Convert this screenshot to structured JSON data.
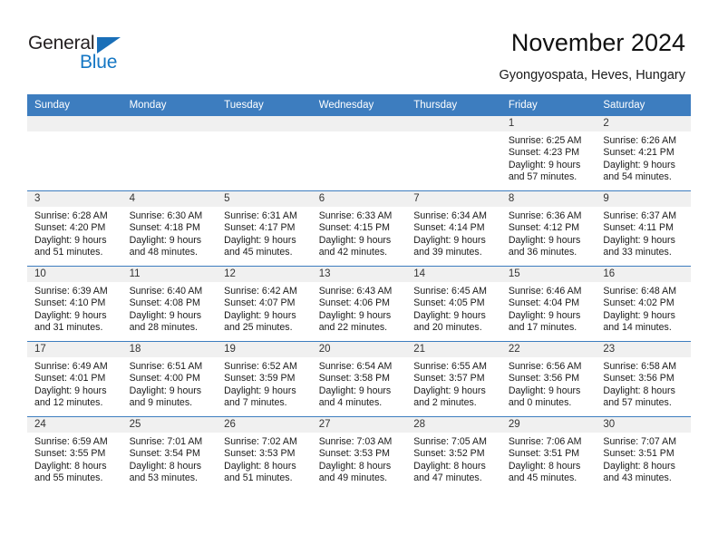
{
  "brand": {
    "name_top": "General",
    "name_bottom": "Blue"
  },
  "header": {
    "title": "November 2024",
    "subtitle": "Gyongyospata, Heves, Hungary"
  },
  "calendar": {
    "weekday_headers": [
      "Sunday",
      "Monday",
      "Tuesday",
      "Wednesday",
      "Thursday",
      "Friday",
      "Saturday"
    ],
    "accent_color": "#3d7dbf",
    "daynum_background": "#f0f0f0",
    "weeks": [
      [
        {
          "day": "",
          "empty": true
        },
        {
          "day": "",
          "empty": true
        },
        {
          "day": "",
          "empty": true
        },
        {
          "day": "",
          "empty": true
        },
        {
          "day": "",
          "empty": true
        },
        {
          "day": "1",
          "sunrise": "Sunrise: 6:25 AM",
          "sunset": "Sunset: 4:23 PM",
          "daylight_line1": "Daylight: 9 hours",
          "daylight_line2": "and 57 minutes."
        },
        {
          "day": "2",
          "sunrise": "Sunrise: 6:26 AM",
          "sunset": "Sunset: 4:21 PM",
          "daylight_line1": "Daylight: 9 hours",
          "daylight_line2": "and 54 minutes."
        }
      ],
      [
        {
          "day": "3",
          "sunrise": "Sunrise: 6:28 AM",
          "sunset": "Sunset: 4:20 PM",
          "daylight_line1": "Daylight: 9 hours",
          "daylight_line2": "and 51 minutes."
        },
        {
          "day": "4",
          "sunrise": "Sunrise: 6:30 AM",
          "sunset": "Sunset: 4:18 PM",
          "daylight_line1": "Daylight: 9 hours",
          "daylight_line2": "and 48 minutes."
        },
        {
          "day": "5",
          "sunrise": "Sunrise: 6:31 AM",
          "sunset": "Sunset: 4:17 PM",
          "daylight_line1": "Daylight: 9 hours",
          "daylight_line2": "and 45 minutes."
        },
        {
          "day": "6",
          "sunrise": "Sunrise: 6:33 AM",
          "sunset": "Sunset: 4:15 PM",
          "daylight_line1": "Daylight: 9 hours",
          "daylight_line2": "and 42 minutes."
        },
        {
          "day": "7",
          "sunrise": "Sunrise: 6:34 AM",
          "sunset": "Sunset: 4:14 PM",
          "daylight_line1": "Daylight: 9 hours",
          "daylight_line2": "and 39 minutes."
        },
        {
          "day": "8",
          "sunrise": "Sunrise: 6:36 AM",
          "sunset": "Sunset: 4:12 PM",
          "daylight_line1": "Daylight: 9 hours",
          "daylight_line2": "and 36 minutes."
        },
        {
          "day": "9",
          "sunrise": "Sunrise: 6:37 AM",
          "sunset": "Sunset: 4:11 PM",
          "daylight_line1": "Daylight: 9 hours",
          "daylight_line2": "and 33 minutes."
        }
      ],
      [
        {
          "day": "10",
          "sunrise": "Sunrise: 6:39 AM",
          "sunset": "Sunset: 4:10 PM",
          "daylight_line1": "Daylight: 9 hours",
          "daylight_line2": "and 31 minutes."
        },
        {
          "day": "11",
          "sunrise": "Sunrise: 6:40 AM",
          "sunset": "Sunset: 4:08 PM",
          "daylight_line1": "Daylight: 9 hours",
          "daylight_line2": "and 28 minutes."
        },
        {
          "day": "12",
          "sunrise": "Sunrise: 6:42 AM",
          "sunset": "Sunset: 4:07 PM",
          "daylight_line1": "Daylight: 9 hours",
          "daylight_line2": "and 25 minutes."
        },
        {
          "day": "13",
          "sunrise": "Sunrise: 6:43 AM",
          "sunset": "Sunset: 4:06 PM",
          "daylight_line1": "Daylight: 9 hours",
          "daylight_line2": "and 22 minutes."
        },
        {
          "day": "14",
          "sunrise": "Sunrise: 6:45 AM",
          "sunset": "Sunset: 4:05 PM",
          "daylight_line1": "Daylight: 9 hours",
          "daylight_line2": "and 20 minutes."
        },
        {
          "day": "15",
          "sunrise": "Sunrise: 6:46 AM",
          "sunset": "Sunset: 4:04 PM",
          "daylight_line1": "Daylight: 9 hours",
          "daylight_line2": "and 17 minutes."
        },
        {
          "day": "16",
          "sunrise": "Sunrise: 6:48 AM",
          "sunset": "Sunset: 4:02 PM",
          "daylight_line1": "Daylight: 9 hours",
          "daylight_line2": "and 14 minutes."
        }
      ],
      [
        {
          "day": "17",
          "sunrise": "Sunrise: 6:49 AM",
          "sunset": "Sunset: 4:01 PM",
          "daylight_line1": "Daylight: 9 hours",
          "daylight_line2": "and 12 minutes."
        },
        {
          "day": "18",
          "sunrise": "Sunrise: 6:51 AM",
          "sunset": "Sunset: 4:00 PM",
          "daylight_line1": "Daylight: 9 hours",
          "daylight_line2": "and 9 minutes."
        },
        {
          "day": "19",
          "sunrise": "Sunrise: 6:52 AM",
          "sunset": "Sunset: 3:59 PM",
          "daylight_line1": "Daylight: 9 hours",
          "daylight_line2": "and 7 minutes."
        },
        {
          "day": "20",
          "sunrise": "Sunrise: 6:54 AM",
          "sunset": "Sunset: 3:58 PM",
          "daylight_line1": "Daylight: 9 hours",
          "daylight_line2": "and 4 minutes."
        },
        {
          "day": "21",
          "sunrise": "Sunrise: 6:55 AM",
          "sunset": "Sunset: 3:57 PM",
          "daylight_line1": "Daylight: 9 hours",
          "daylight_line2": "and 2 minutes."
        },
        {
          "day": "22",
          "sunrise": "Sunrise: 6:56 AM",
          "sunset": "Sunset: 3:56 PM",
          "daylight_line1": "Daylight: 9 hours",
          "daylight_line2": "and 0 minutes."
        },
        {
          "day": "23",
          "sunrise": "Sunrise: 6:58 AM",
          "sunset": "Sunset: 3:56 PM",
          "daylight_line1": "Daylight: 8 hours",
          "daylight_line2": "and 57 minutes."
        }
      ],
      [
        {
          "day": "24",
          "sunrise": "Sunrise: 6:59 AM",
          "sunset": "Sunset: 3:55 PM",
          "daylight_line1": "Daylight: 8 hours",
          "daylight_line2": "and 55 minutes."
        },
        {
          "day": "25",
          "sunrise": "Sunrise: 7:01 AM",
          "sunset": "Sunset: 3:54 PM",
          "daylight_line1": "Daylight: 8 hours",
          "daylight_line2": "and 53 minutes."
        },
        {
          "day": "26",
          "sunrise": "Sunrise: 7:02 AM",
          "sunset": "Sunset: 3:53 PM",
          "daylight_line1": "Daylight: 8 hours",
          "daylight_line2": "and 51 minutes."
        },
        {
          "day": "27",
          "sunrise": "Sunrise: 7:03 AM",
          "sunset": "Sunset: 3:53 PM",
          "daylight_line1": "Daylight: 8 hours",
          "daylight_line2": "and 49 minutes."
        },
        {
          "day": "28",
          "sunrise": "Sunrise: 7:05 AM",
          "sunset": "Sunset: 3:52 PM",
          "daylight_line1": "Daylight: 8 hours",
          "daylight_line2": "and 47 minutes."
        },
        {
          "day": "29",
          "sunrise": "Sunrise: 7:06 AM",
          "sunset": "Sunset: 3:51 PM",
          "daylight_line1": "Daylight: 8 hours",
          "daylight_line2": "and 45 minutes."
        },
        {
          "day": "30",
          "sunrise": "Sunrise: 7:07 AM",
          "sunset": "Sunset: 3:51 PM",
          "daylight_line1": "Daylight: 8 hours",
          "daylight_line2": "and 43 minutes."
        }
      ]
    ]
  }
}
